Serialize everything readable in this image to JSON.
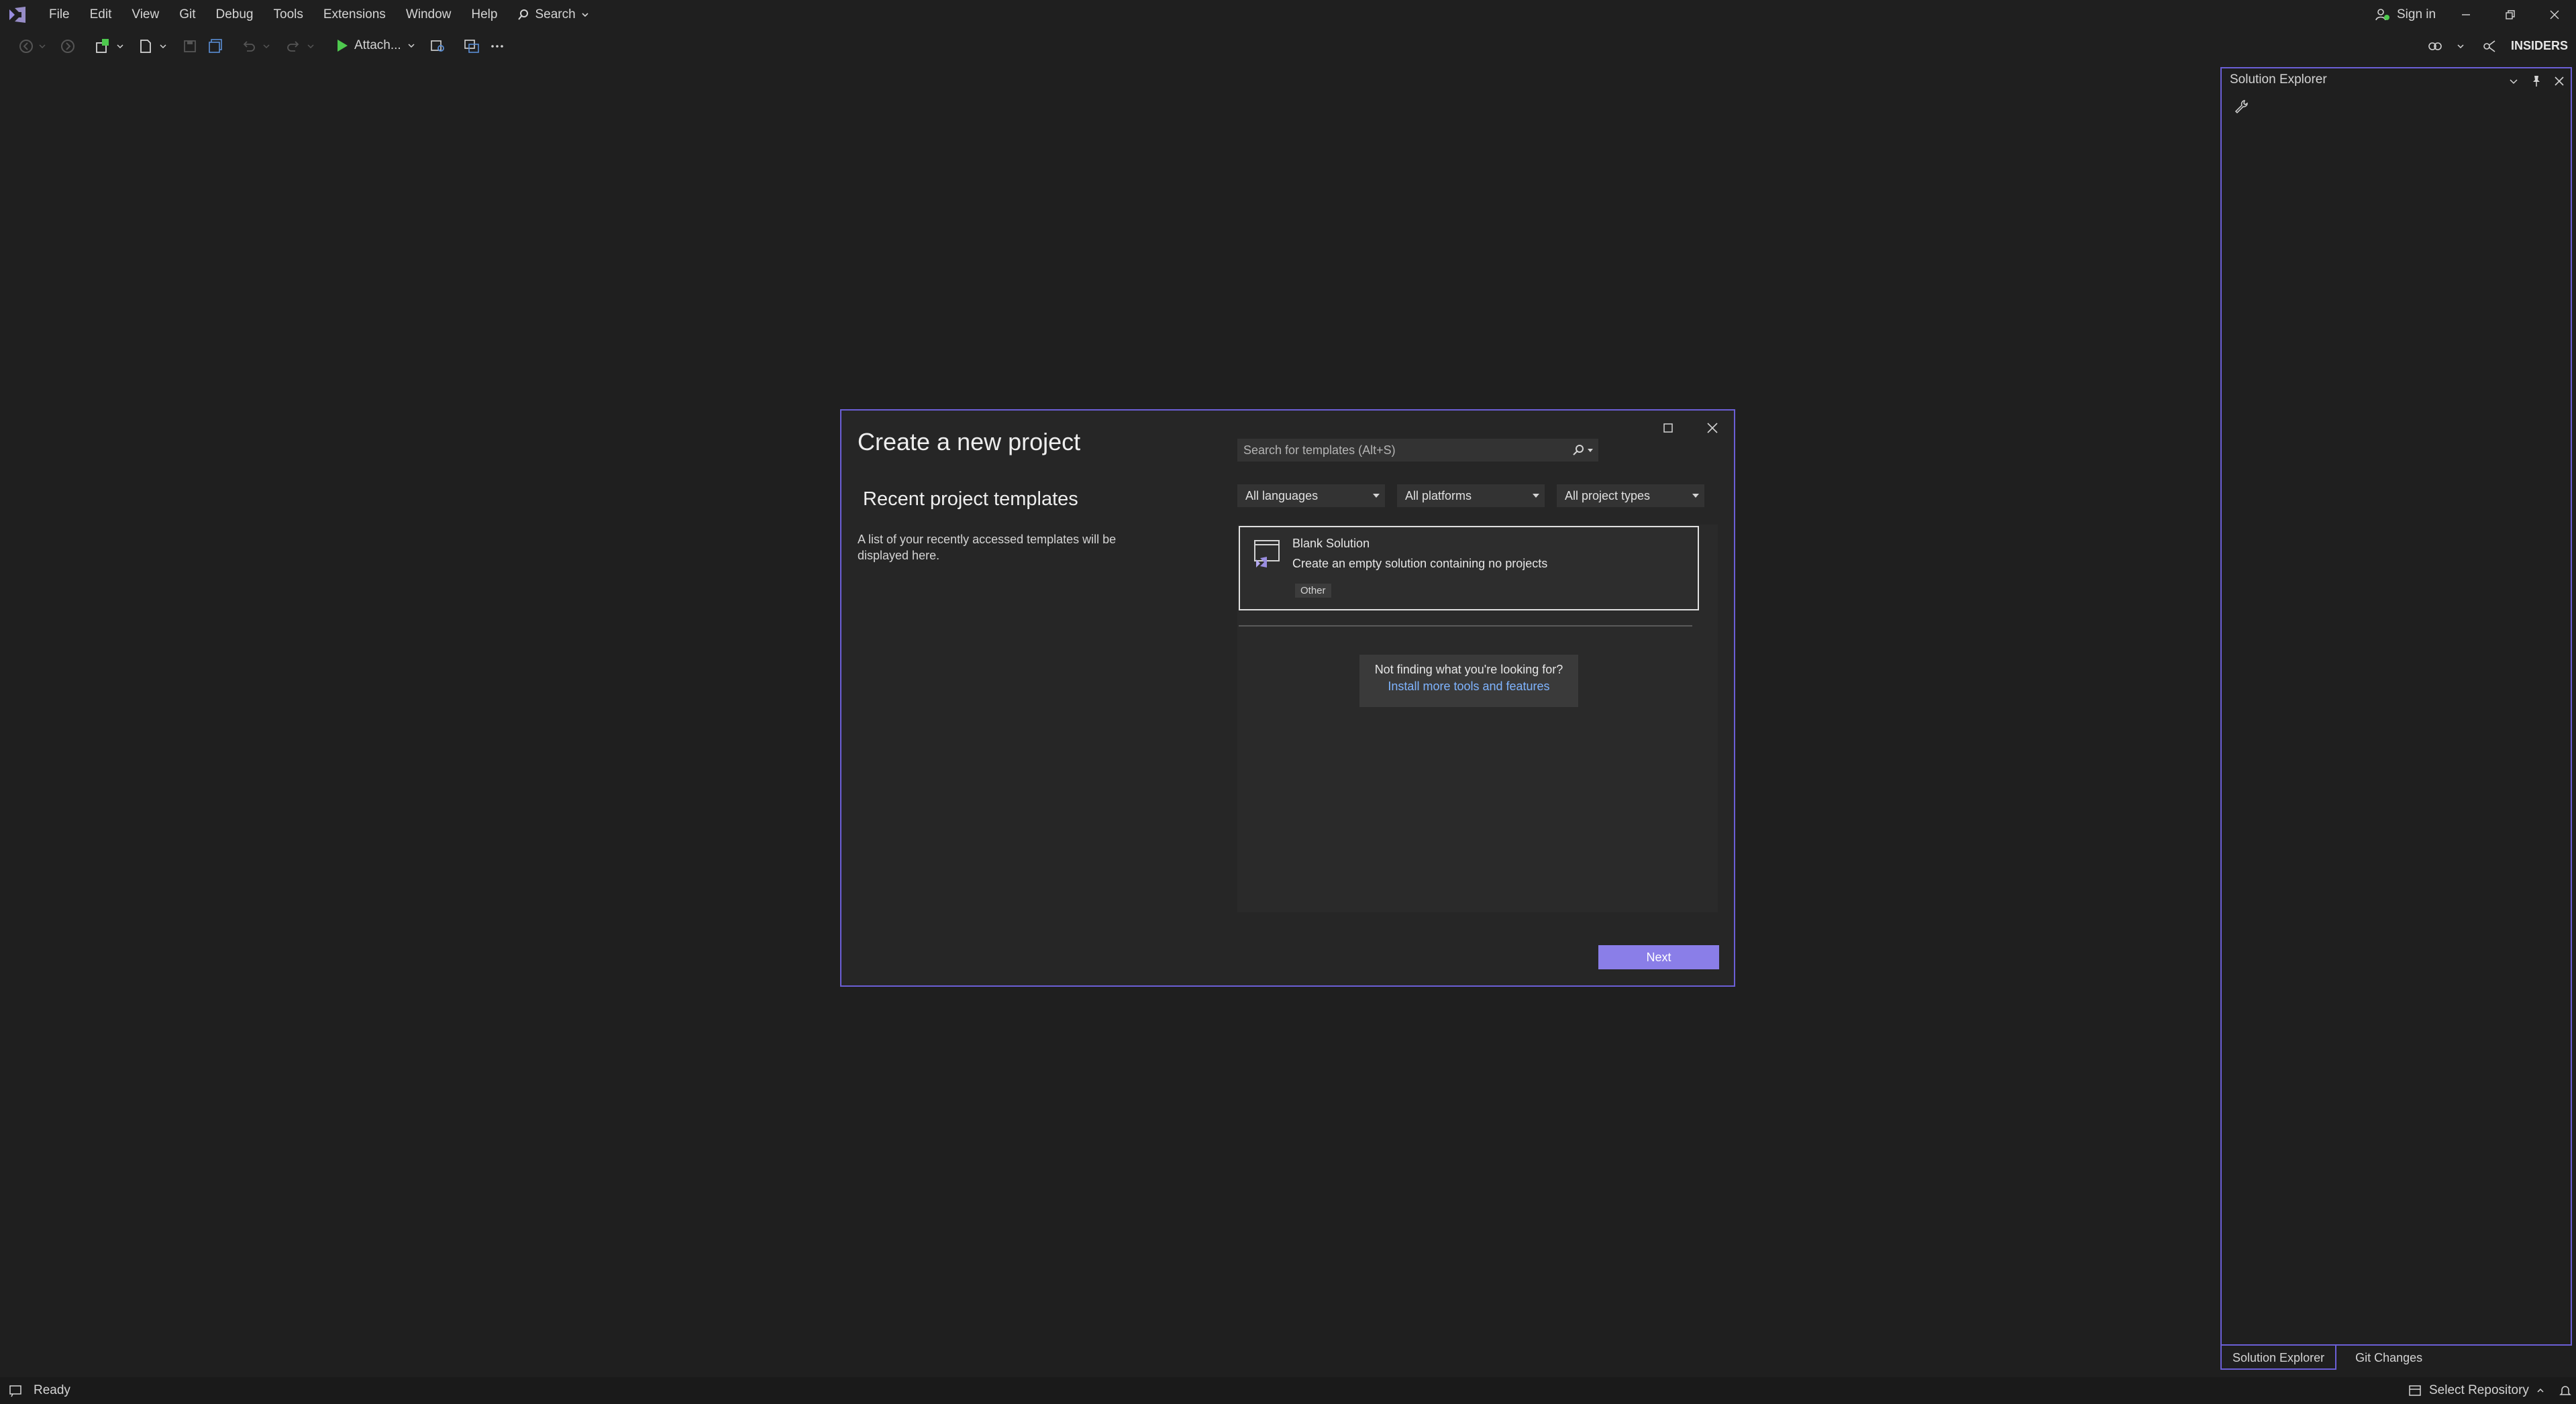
{
  "menubar": {
    "items": [
      "File",
      "Edit",
      "View",
      "Git",
      "Debug",
      "Tools",
      "Extensions",
      "Window",
      "Help"
    ],
    "search_label": "Search",
    "sign_in": "Sign in"
  },
  "toolbar": {
    "attach_label": "Attach...",
    "badge": "INSIDERS"
  },
  "dialog": {
    "title": "Create a new project",
    "recent_heading": "Recent project templates",
    "recent_desc": "A list of your recently accessed templates will be displayed here.",
    "search_placeholder": "Search for templates (Alt+S)",
    "filters": {
      "language": "All languages",
      "platform": "All platforms",
      "project_type": "All project types"
    },
    "template": {
      "name": "Blank Solution",
      "description": "Create an empty solution containing no projects",
      "tag": "Other"
    },
    "not_finding": "Not finding what you're looking for?",
    "install_link": "Install more tools and features",
    "next": "Next"
  },
  "solution_explorer": {
    "title": "Solution Explorer",
    "tabs": [
      "Solution Explorer",
      "Git Changes"
    ]
  },
  "status": {
    "ready": "Ready",
    "repo": "Select Repository"
  },
  "colors": {
    "accent": "#6b5fd6",
    "button": "#8a7ee8",
    "link": "#7fb4ff",
    "run": "#4ec94e",
    "background": "#1f1f1f"
  }
}
